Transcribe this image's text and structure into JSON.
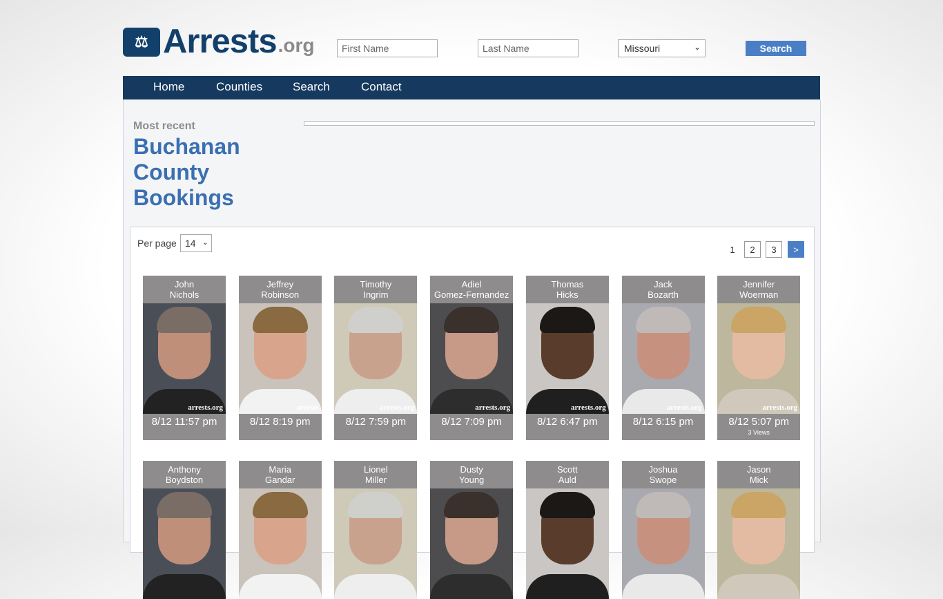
{
  "logo": {
    "brand": "Arrests",
    "tld": ".org",
    "badge_icon": "handcuffs-icon"
  },
  "search": {
    "first_placeholder": "First Name",
    "last_placeholder": "Last Name",
    "state_selected": "Missouri",
    "button_label": "Search"
  },
  "nav": {
    "items": [
      "Home",
      "Counties",
      "Search",
      "Contact"
    ]
  },
  "page": {
    "kicker": "Most recent",
    "title": "Buchanan County Bookings"
  },
  "list": {
    "per_page_label": "Per page",
    "per_page_value": "14",
    "pagination": [
      "1",
      "2",
      "3",
      ">"
    ],
    "bookings": [
      {
        "first": "John",
        "last": "Nichols",
        "time": "8/12 11:57 pm",
        "watermark": "arrests.org"
      },
      {
        "first": "Jeffrey",
        "last": "Robinson",
        "time": "8/12 8:19 pm",
        "watermark": "arrests"
      },
      {
        "first": "Timothy",
        "last": "Ingrim",
        "time": "8/12 7:59 pm",
        "watermark": "arrests.org"
      },
      {
        "first": "Adiel",
        "last": "Gomez-Fernandez",
        "time": "8/12 7:09 pm",
        "watermark": "arrests.org"
      },
      {
        "first": "Thomas",
        "last": "Hicks",
        "time": "8/12 6:47 pm",
        "watermark": "arrests.org"
      },
      {
        "first": "Jack",
        "last": "Bozarth",
        "time": "8/12 6:15 pm",
        "watermark": "arrests.org"
      },
      {
        "first": "Jennifer",
        "last": "Woerman",
        "time": "8/12 5:07 pm",
        "views": "3 Views",
        "watermark": "arrests.org"
      },
      {
        "first": "Anthony",
        "last": "Boydston"
      },
      {
        "first": "Maria",
        "last": "Gandar"
      },
      {
        "first": "Lionel",
        "last": "Miller"
      },
      {
        "first": "Dusty",
        "last": "Young"
      },
      {
        "first": "Scott",
        "last": "Auld"
      },
      {
        "first": "Joshua",
        "last": "Swope"
      },
      {
        "first": "Jason",
        "last": "Mick"
      }
    ]
  }
}
